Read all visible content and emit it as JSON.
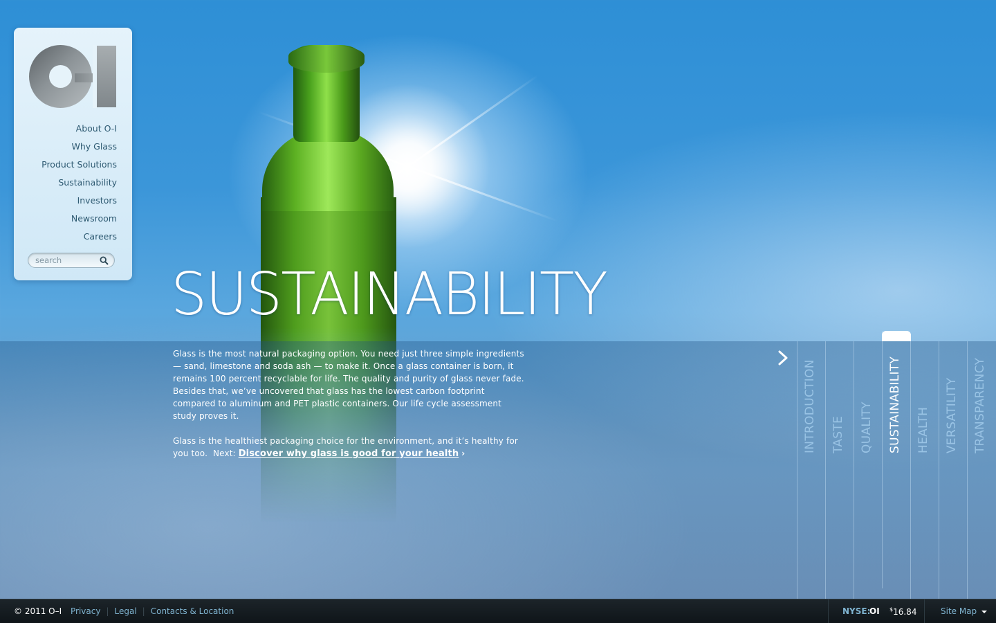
{
  "nav": {
    "items": [
      "About O-I",
      "Why Glass",
      "Product Solutions",
      "Sustainability",
      "Investors",
      "Newsroom",
      "Careers"
    ]
  },
  "search": {
    "placeholder": "search"
  },
  "hero": {
    "title": "SUSTAINABILITY",
    "paragraph1": "Glass is the most natural packaging option. You need just three simple ingredients — sand, limestone and soda ash — to make it. Once a glass container is born, it remains 100 percent recyclable for life. The quality and purity of glass never fade. Besides that, we’ve uncovered that glass has the lowest carbon footprint compared to aluminum and PET plastic containers. Our life cycle assessment study proves it.",
    "paragraph2": "Glass is the healthiest packaging choice for the environment, and it’s healthy for you too.",
    "next_label": "Next:",
    "next_link": "Discover why glass is good for your health",
    "next_arrow": "›"
  },
  "tabs": {
    "items": [
      "INTRODUCTION",
      "TASTE",
      "QUALITY",
      "SUSTAINABILITY",
      "HEALTH",
      "VERSATILITY",
      "TRANSPARENCY"
    ],
    "active_index": 3
  },
  "footer": {
    "copyright": "© 2011 O–I",
    "links": [
      "Privacy",
      "Legal",
      "Contacts & Location"
    ],
    "stock_exchange": "NYSE:",
    "stock_ticker": "OI",
    "stock_currency": "$",
    "stock_price": "16.84",
    "site_map": "Site Map"
  },
  "colors": {
    "sky": "#3b96d9",
    "nav_text": "#2e5a72",
    "footer_bg": "#151c20",
    "footer_link": "#7fb3cf"
  }
}
